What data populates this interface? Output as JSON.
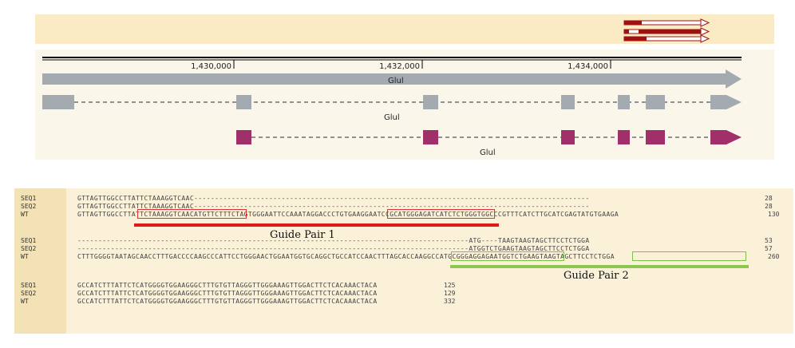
{
  "browser": {
    "ruler": {
      "ticks": [
        {
          "label": "1,430,000",
          "pos": 1430000
        },
        {
          "label": "1,432,000",
          "pos": 1432000
        },
        {
          "label": "1,434,000",
          "pos": 1434000
        }
      ]
    },
    "tracks": {
      "gene_label": "Glul",
      "transcript1_label": "Glul",
      "transcript2_label": "Glul"
    },
    "colors": {
      "overview_bg": "#fbebc4",
      "track_bg": "#fbf6ea",
      "gene_gray": "#a3abb1",
      "transcript_purple": "#a1306a",
      "mini_red": "#a01010"
    }
  },
  "alignment": {
    "block1": {
      "names": [
        "SEQ1",
        "SEQ2",
        "WT"
      ],
      "seq1": "GTTAGTTGGCCTTATTCTAAAGGTCAAC-----------------------------------------------------------------------------------------------",
      "seq2": "GTTAGTTGGCCTTATTCTAAAGGTCAAC-----------------------------------------------------------------------------------------------",
      "wt": "GTTAGTTGGCCTTATTCTAAAGGTCAACATGTTCTTTCTAGTGGGAATTCCAAATAGGACCCTGTGAAGGAATCCGCATGGGAGATCATCTCTGGGTGGCCCGTTTCATCTTGCATCGAGTATGTGAAGA",
      "ends": [
        "28",
        "28",
        "130"
      ]
    },
    "block2": {
      "names": [
        "SEQ1",
        "SEQ2",
        "WT"
      ],
      "seq1": "----------------------------------------------------------------------------------------------ATG----TAAGTAAGTAGCTTCCTCTGGA",
      "seq2": "----------------------------------------------------------------------------------------------ATGGTCTGAAGTAAGTAGCTTCCTCTGGA",
      "wt": "CTTTGGGGTAATAGCAACCTTTGACCCCAAGCCCATTCCTGGGAACTGGAATGGTGCAGGCTGCCATCCAACTTTAGCACCAAGGCCATGCGGGAGGAGAATGGTCTGAAGTAAGTAGCTTCCTCTGGA",
      "ends": [
        "53",
        "57",
        "260"
      ]
    },
    "block3": {
      "names": [
        "SEQ1",
        "SEQ2",
        "WT"
      ],
      "seq1": "GCCATCTTTATTCTCATGGGGTGGAAGGGCTTTGTGTTAGGGTTGGGAAAGTTGGACTTCTCACAAACTACA",
      "seq2": "GCCATCTTTATTCTCATGGGGTGGAAGGGCTTTGTGTTAGGGTTGGGAAAGTTGGACTTCTCACAAACTACA",
      "wt": "GCCATCTTTATTCTCATGGGGTGGAAGGGCTTTGTGTTAGGGTTGGGAAAGTTGGACTTCTCACAAACTACA",
      "ends": [
        "125",
        "129",
        "332"
      ]
    },
    "guides": {
      "pair1_label": "Guide Pair 1",
      "pair2_label": "Guide Pair 2",
      "pair1_color": "#e01a1a",
      "pair2_color": "#8cc850"
    }
  }
}
